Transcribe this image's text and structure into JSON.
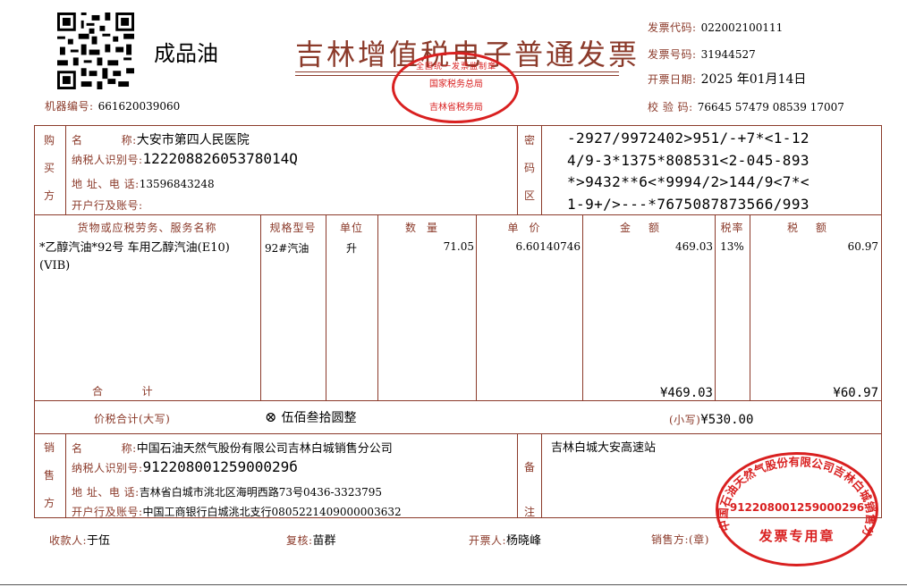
{
  "header": {
    "title": "吉林增值税电子普通发票",
    "product_type": "成品油",
    "machine_no_label": "机器编号:",
    "machine_no": "661620039060",
    "code_label": "发票代码:",
    "code": "022002100111",
    "number_label": "发票号码:",
    "number": "31944527",
    "date_label": "开票日期:",
    "date": "2025 年01月14日",
    "check_label": "校 验 码:",
    "check_code": "76645 57479 08539 17007",
    "qr_icon": "qr-code-icon"
  },
  "tax_stamp": {
    "top": "全国统一发票监制章",
    "middle": "国家税务总局",
    "bottom": "吉林省税务局",
    "color": "#d92020"
  },
  "buyer": {
    "side_label": "购买方",
    "name_label": "名          称:",
    "name": "大安市第四人民医院",
    "taxid_label": "纳税人识别号:",
    "taxid": "12220882605378014Q",
    "addr_label": "地 址、电 话:",
    "addr": "13596843248",
    "bank_label": "开户行及账号:",
    "bank": ""
  },
  "cipher": {
    "side_label": "密码区",
    "lines": [
      "-2927/9972402>951/-+7*<1-12",
      "4/9-3*1375*808531<2-045-893",
      "*>9432**6<*9994/2>144/9<7*<",
      "1-9+/>---*7675087873566/993"
    ]
  },
  "items": {
    "headers": [
      "货物或应税劳务、服务名称",
      "规格型号",
      "单位",
      "数量",
      "单价",
      "金额",
      "税率",
      "税额"
    ],
    "rows": [
      {
        "name": "*乙醇汽油*92号 车用乙醇汽油(E10)(VIB)",
        "spec": "92#汽油",
        "unit": "升",
        "qty": "71.05",
        "price": "6.60140746",
        "amount": "469.03",
        "rate": "13%",
        "tax": "60.97"
      }
    ],
    "total_label": "合          计",
    "total_amount": "¥469.03",
    "total_tax": "¥60.97"
  },
  "total": {
    "label": "价税合计(大写)",
    "icon": "circle-x-icon",
    "upper": "伍佰叁拾圆整",
    "small_label": "(小写)",
    "small": "¥530.00"
  },
  "seller": {
    "side_label": "销售方",
    "name_label": "名          称:",
    "name": "中国石油天然气股份有限公司吉林白城销售分公司",
    "taxid_label": "纳税人识别号:",
    "taxid": "91220800125900029б",
    "addr_label": "地 址、电 话:",
    "addr": "吉林省白城市洮北区海明西路73号0436-3323795",
    "bank_label": "开户行及账号:",
    "bank": "中国工商银行白城洮北支行0805221409000003632"
  },
  "remarks": {
    "side_label": "备注",
    "text": "吉林白城大安高速站"
  },
  "seller_stamp": {
    "ring": "中国石油天然气股份有限公司吉林白城销售分公司",
    "number": "912208001259000296",
    "label": "发票专用章",
    "color": "#d92020"
  },
  "footer": {
    "payee_label": "收款人:",
    "payee": "于伍",
    "reviewer_label": "复核:",
    "reviewer": "苗群",
    "issuer_label": "开票人:",
    "issuer": "杨晓峰",
    "seller_label": "销售方:(章)"
  }
}
